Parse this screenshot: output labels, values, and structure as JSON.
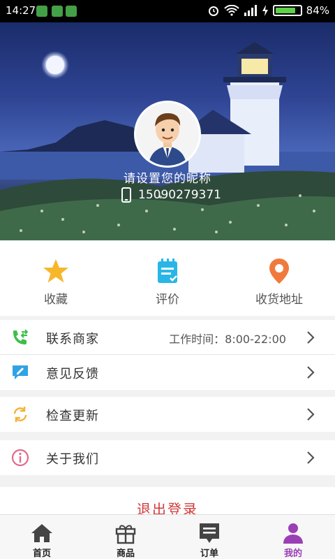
{
  "status_bar": {
    "time": "14:27",
    "battery_text": "84%",
    "battery_level": 0.84
  },
  "profile": {
    "nickname": "请设置您的昵称",
    "phone": "15090279371"
  },
  "quick_actions": [
    {
      "label": "收藏",
      "icon": "star-icon",
      "color": "#f6b72b"
    },
    {
      "label": "评价",
      "icon": "review-icon",
      "color": "#29b6e6"
    },
    {
      "label": "收货地址",
      "icon": "location-pin-icon",
      "color": "#f07a3d"
    }
  ],
  "menu": {
    "contact": {
      "label": "联系商家",
      "extra": "工作时间：8:00-22:00",
      "icon": "phone-transfer-icon",
      "color": "#3cbf4a"
    },
    "feedback": {
      "label": "意见反馈",
      "icon": "feedback-icon",
      "color": "#2fa3e6"
    },
    "update": {
      "label": "检查更新",
      "icon": "refresh-icon",
      "color": "#f4b23a"
    },
    "about": {
      "label": "关于我们",
      "icon": "info-icon",
      "color": "#e06a8a"
    }
  },
  "logout_label": "退出登录",
  "bottom_nav": [
    {
      "label": "首页",
      "icon": "home-icon",
      "active": false
    },
    {
      "label": "商品",
      "icon": "gift-icon",
      "active": false
    },
    {
      "label": "订单",
      "icon": "order-icon",
      "active": false
    },
    {
      "label": "我的",
      "icon": "person-icon",
      "active": true
    }
  ],
  "accent_color": "#9a3fb5"
}
